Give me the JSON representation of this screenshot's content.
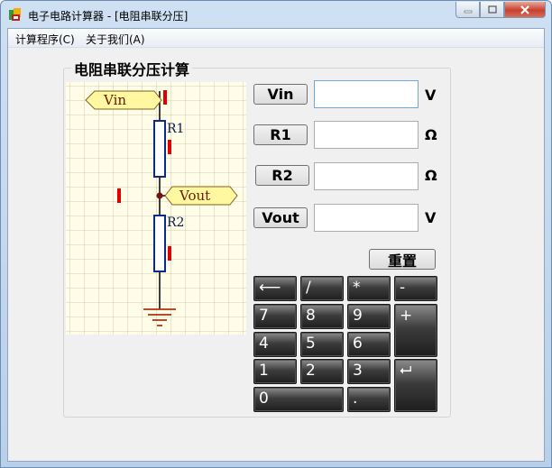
{
  "window": {
    "title": "电子电路计算器 - [电阻串联分压]"
  },
  "menu": [
    {
      "label": "计算程序(C)"
    },
    {
      "label": "关于我们(A)"
    }
  ],
  "panel": {
    "title": "电阻串联分压计算"
  },
  "circuit": {
    "vin_tag": "Vin",
    "vout_tag": "Vout",
    "r1_label": "R1",
    "r2_label": "R2"
  },
  "fields": [
    {
      "button": "Vin",
      "value": "",
      "unit": "V"
    },
    {
      "button": "R1",
      "value": "",
      "unit": "Ω"
    },
    {
      "button": "R2",
      "value": "",
      "unit": "Ω"
    },
    {
      "button": "Vout",
      "value": "",
      "unit": "V"
    }
  ],
  "reset_label": "重置",
  "keypad": {
    "backspace": "⟵",
    "divide": "/",
    "multiply": "*",
    "minus": "-",
    "seven": "7",
    "eight": "8",
    "nine": "9",
    "plus": "+",
    "four": "4",
    "five": "5",
    "six": "6",
    "one": "1",
    "two": "2",
    "three": "3",
    "enter": "⮠",
    "zero": "0",
    "dot": "."
  },
  "colors": {
    "tag_fill": "#fff8a0",
    "wire": "#000000",
    "resistor": "#0a2a8a",
    "marker": "#e00000",
    "grid": "#c8c0a0",
    "circuit_bg": "#fffde8",
    "ground": "#b03010"
  }
}
